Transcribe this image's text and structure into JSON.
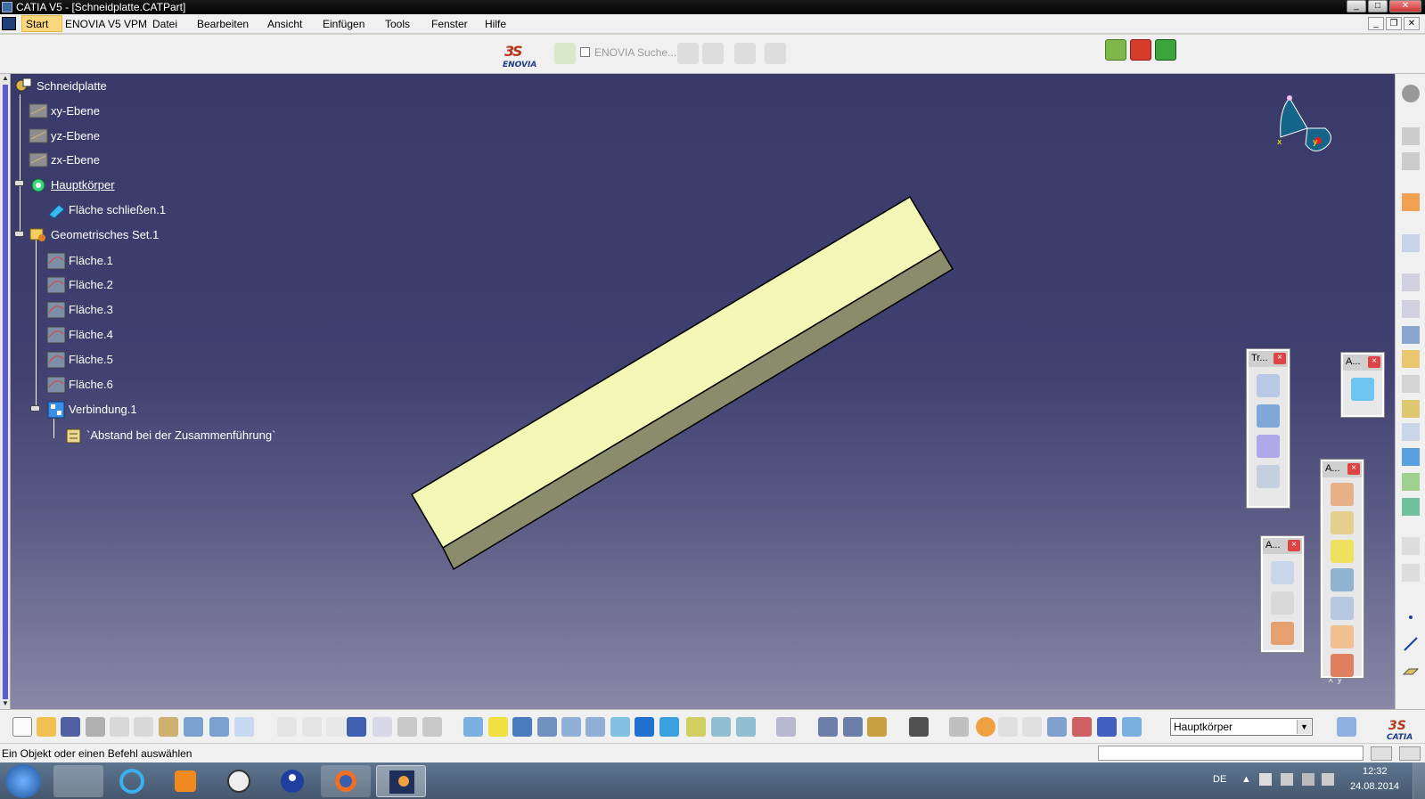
{
  "window": {
    "title": "CATIA V5 - [Schneidplatte.CATPart]"
  },
  "menu": {
    "items": [
      "Start",
      "ENOVIA V5 VPM",
      "Datei",
      "Bearbeiten",
      "Ansicht",
      "Einfügen",
      "Tools",
      "Fenster",
      "Hilfe"
    ]
  },
  "topbar": {
    "enovia_search": "ENOVIA Suche..."
  },
  "tree": {
    "root": "Schneidplatte",
    "planes": [
      "xy-Ebene",
      "yz-Ebene",
      "zx-Ebene"
    ],
    "body": "Hauptkörper",
    "body_feature": "Fläche schließen.1",
    "geoset": "Geometrisches Set.1",
    "surfaces": [
      "Fläche.1",
      "Fläche.2",
      "Fläche.3",
      "Fläche.4",
      "Fläche.5",
      "Fläche.6"
    ],
    "join": "Verbindung.1",
    "join_param": "`Abstand bei der Zusammenführung`"
  },
  "floating_toolbars": {
    "transform": "Tr...",
    "a1": "A...",
    "a2": "A...",
    "a3": "A...",
    "close": "×"
  },
  "compass_labels": {
    "x": "x",
    "y": "y"
  },
  "corner_axis": "x y",
  "body_selector": {
    "value": "Hauptkörper"
  },
  "status": {
    "message": "Ein Objekt oder einen Befehl auswählen"
  },
  "taskbar": {
    "lang": "DE",
    "time": "12:32",
    "date": "24.08.2014"
  },
  "colors": {
    "viewport_top": "#3a3a6a",
    "part_top": "#f2f7b6",
    "part_side": "#8a8c6b",
    "accent": "#fbd97a"
  }
}
